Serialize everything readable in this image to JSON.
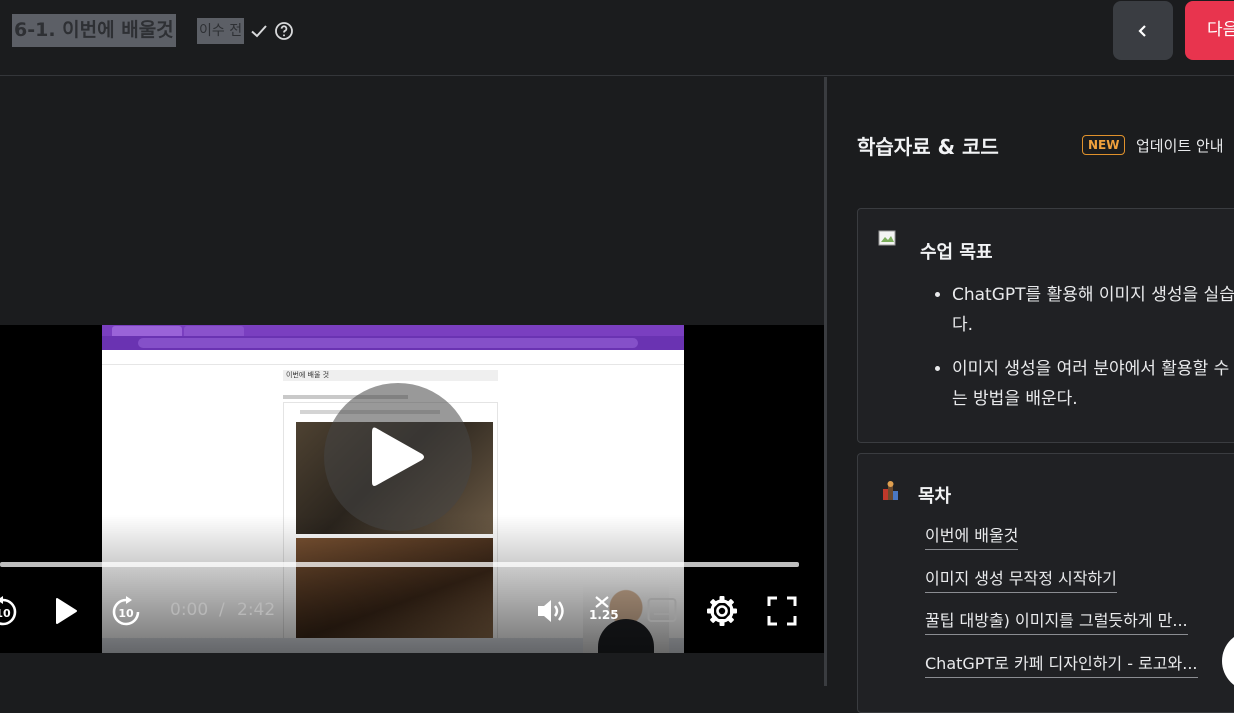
{
  "header": {
    "lesson_title": "6-1. 이번에 배울것",
    "completion_status": "이수 전",
    "next_label": "다음"
  },
  "player": {
    "current_time": "0:00",
    "separator": "/",
    "duration": "2:42",
    "playback_speed": "1.25",
    "progress": 0.0,
    "captured_page_heading": "이번에 배울 것"
  },
  "panel": {
    "title": "학습자료 & 코드",
    "badge": "NEW",
    "update_link": "업데이트 안내",
    "goals_card": {
      "title": "수업 목표",
      "goals": [
        "ChatGPT를 활용해 이미지 생성을 실습한다.",
        "이미지 생성을 여러 분야에서 활용할 수 있는 방법을 배운다."
      ]
    },
    "toc_card": {
      "title": "목차",
      "items": [
        "이번에 배울것",
        "이미지 생성 무작정 시작하기",
        "꿀팁 대방출) 이미지를 그럴듯하게 만...",
        "ChatGPT로 카페 디자인하기 - 로고와..."
      ]
    }
  },
  "colors": {
    "background": "#1b1c1e",
    "accent": "#e8344e",
    "badge": "#f0a03c"
  }
}
